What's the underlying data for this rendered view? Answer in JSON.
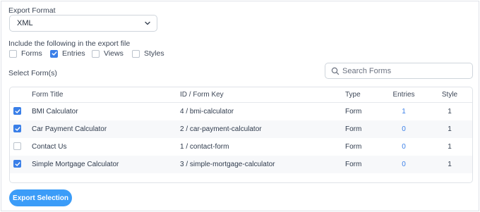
{
  "export_format": {
    "label": "Export Format",
    "selected": "XML"
  },
  "include": {
    "label": "Include the following in the export file",
    "options": [
      {
        "label": "Forms",
        "checked": false
      },
      {
        "label": "Entries",
        "checked": true
      },
      {
        "label": "Views",
        "checked": false
      },
      {
        "label": "Styles",
        "checked": false
      }
    ]
  },
  "select_forms_label": "Select Form(s)",
  "search": {
    "placeholder": "Search Forms"
  },
  "table": {
    "headers": {
      "title": "Form Title",
      "key": "ID / Form Key",
      "type": "Type",
      "entries": "Entries",
      "style": "Style"
    },
    "rows": [
      {
        "checked": true,
        "title": "BMI Calculator",
        "key": "4 / bmi-calculator",
        "type": "Form",
        "entries": "1",
        "style": "1"
      },
      {
        "checked": true,
        "title": "Car Payment Calculator",
        "key": "2 / car-payment-calculator",
        "type": "Form",
        "entries": "0",
        "style": "1"
      },
      {
        "checked": false,
        "title": "Contact Us",
        "key": "1 / contact-form",
        "type": "Form",
        "entries": "0",
        "style": "1"
      },
      {
        "checked": true,
        "title": "Simple Mortgage Calculator",
        "key": "3 / simple-mortgage-calculator",
        "type": "Form",
        "entries": "0",
        "style": "1"
      }
    ]
  },
  "export_button_label": "Export Selection",
  "colors": {
    "accent": "#3a7fe8",
    "button": "#3b9cf8"
  },
  "icons": {
    "select_caret": "chevron-down-icon",
    "search": "search-icon",
    "checked": "checkmark-icon"
  }
}
